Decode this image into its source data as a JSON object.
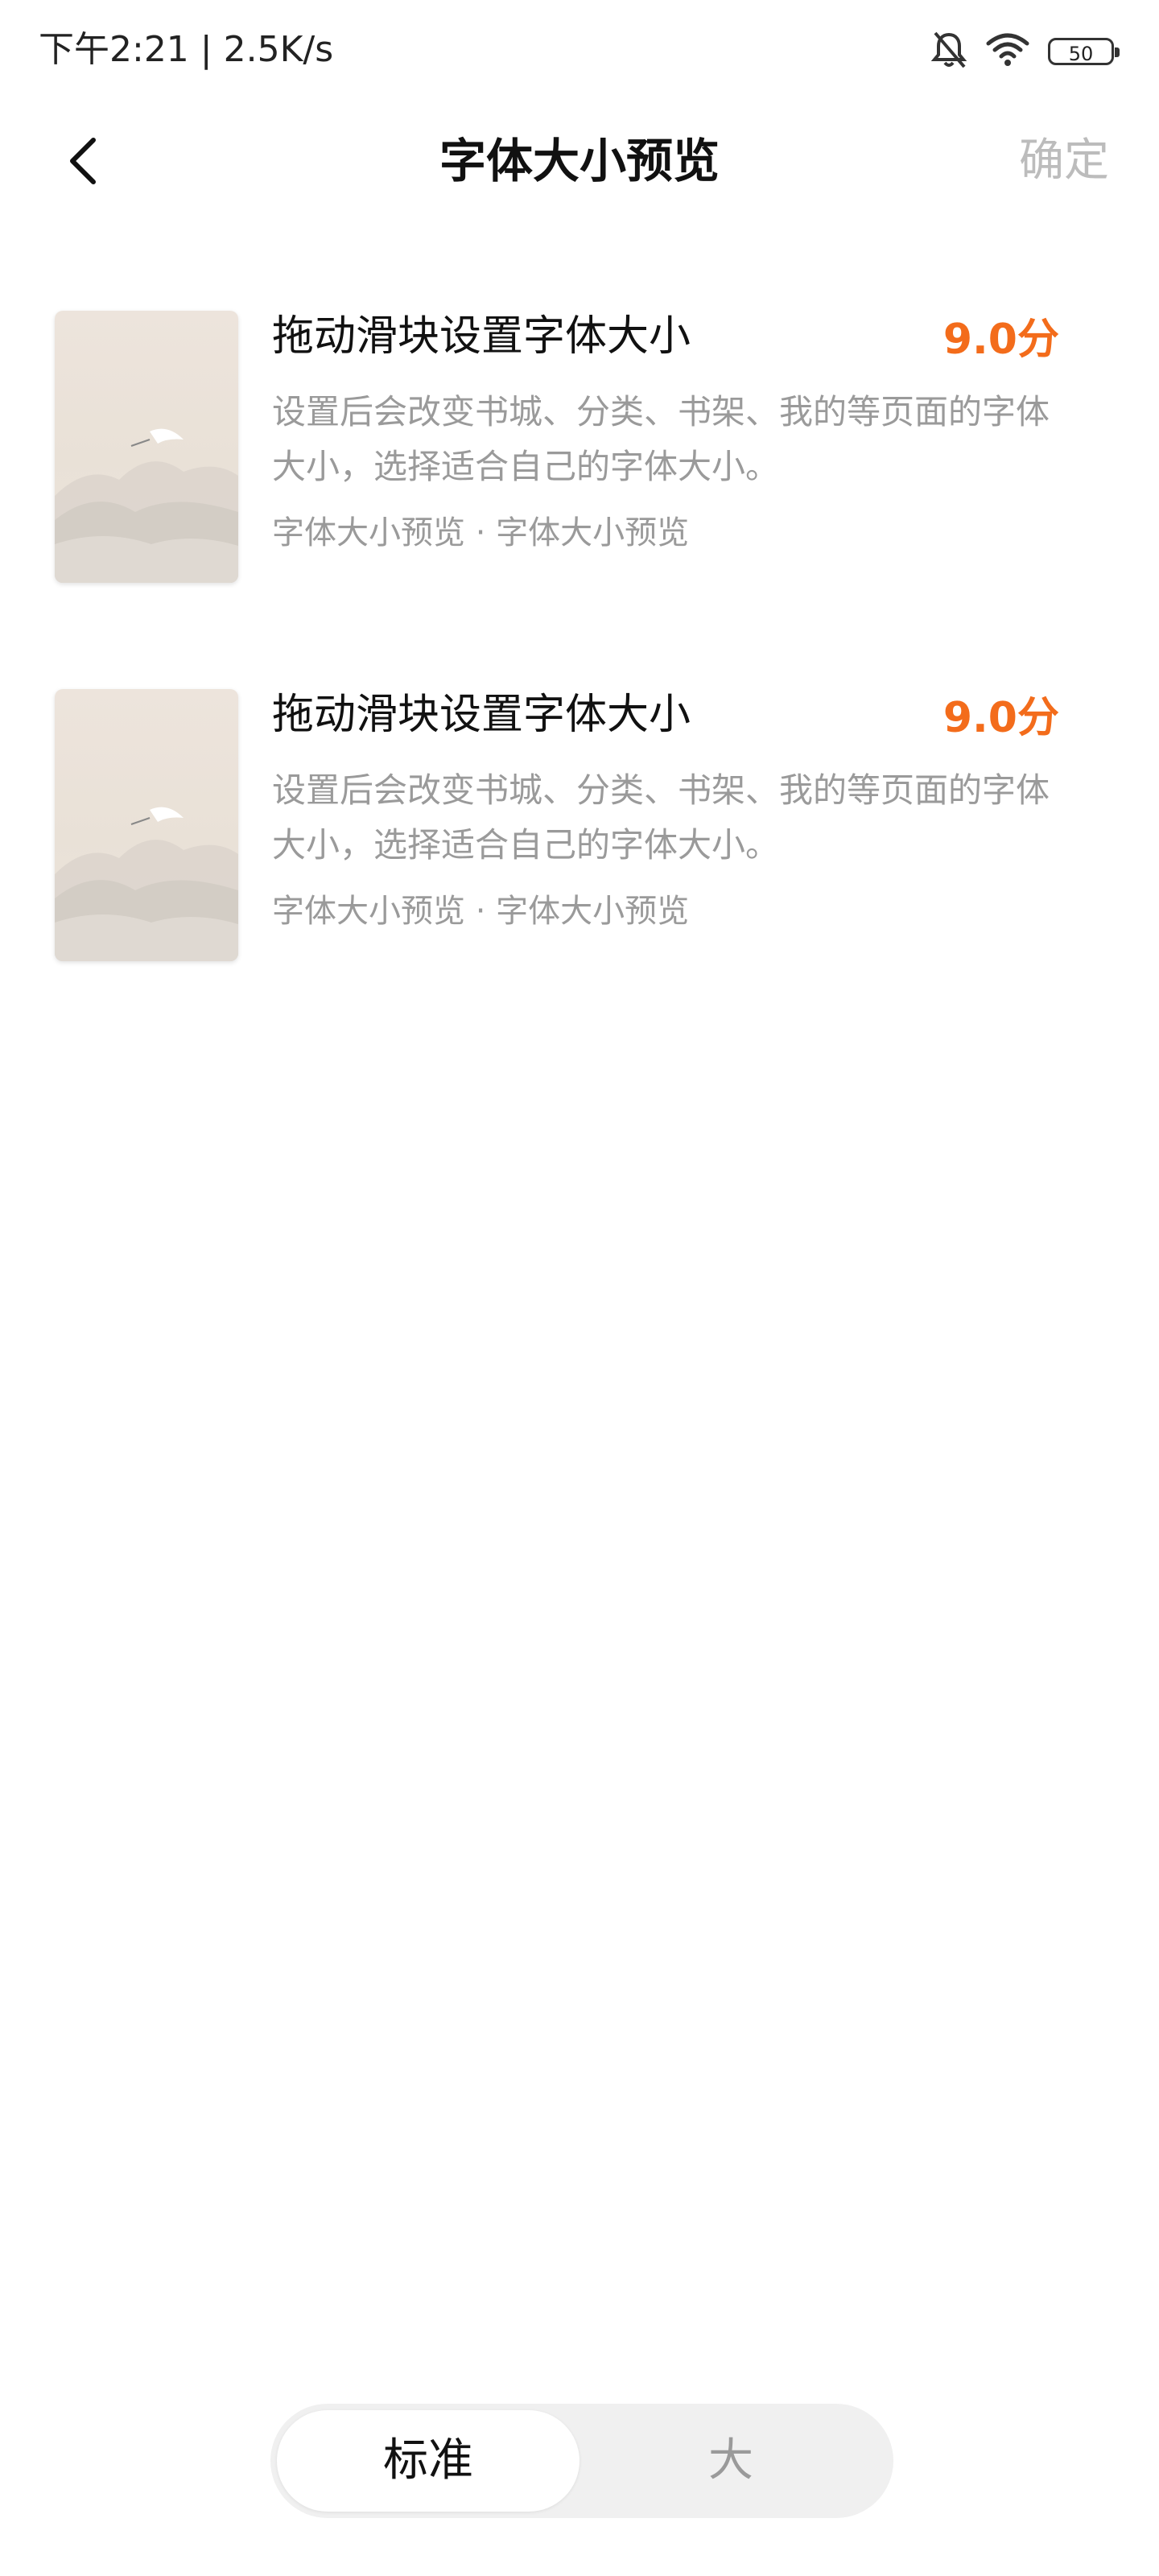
{
  "status_bar": {
    "time": "下午2:21 | 2.5K/s",
    "battery": "50",
    "icons": [
      "bell-off-icon",
      "wifi-icon",
      "battery-icon"
    ]
  },
  "header": {
    "title": "字体大小预览",
    "confirm_label": "确定",
    "back_icon": "chevron-left-icon"
  },
  "books": [
    {
      "title": "拖动滑块设置字体大小",
      "score": "9.0分",
      "description": "设置后会改变书城、分类、书架、我的等页面的字体大小，选择适合自己的字体大小。",
      "tags": "字体大小预览 · 字体大小预览"
    },
    {
      "title": "拖动滑块设置字体大小",
      "score": "9.0分",
      "description": "设置后会改变书城、分类、书架、我的等页面的字体大小，选择适合自己的字体大小。",
      "tags": "字体大小预览 · 字体大小预览"
    }
  ],
  "size_switch": {
    "options": [
      "标准",
      "大"
    ],
    "selected": "标准"
  },
  "colors": {
    "accent": "#f36c1b",
    "muted": "#9a9a9a",
    "switch_bg": "#f0f0f0"
  }
}
